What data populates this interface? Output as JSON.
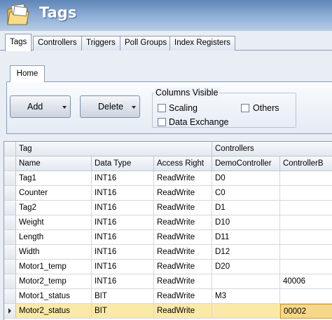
{
  "app": {
    "title": "Tags",
    "icon": "folder-tags-icon"
  },
  "tabs": [
    "Tags",
    "Controllers",
    "Triggers",
    "Poll Groups",
    "Index Registers"
  ],
  "ribbon": {
    "tab": "Home",
    "add_label": "Add",
    "delete_label": "Delete",
    "columns_visible_label": "Columns Visible",
    "checkboxes": {
      "scaling": "Scaling",
      "others": "Others",
      "data_exchange": "Data Exchange"
    }
  },
  "grid": {
    "group_tag": "Tag",
    "group_controllers": "Controllers",
    "columns": [
      "Name",
      "Data Type",
      "Access Right",
      "DemoController",
      "ControllerB"
    ],
    "rows": [
      [
        "Tag1",
        "INT16",
        "ReadWrite",
        "D0",
        ""
      ],
      [
        "Counter",
        "INT16",
        "ReadWrite",
        "C0",
        ""
      ],
      [
        "Tag2",
        "INT16",
        "ReadWrite",
        "D1",
        ""
      ],
      [
        "Weight",
        "INT16",
        "ReadWrite",
        "D10",
        ""
      ],
      [
        "Length",
        "INT16",
        "ReadWrite",
        "D11",
        ""
      ],
      [
        "Width",
        "INT16",
        "ReadWrite",
        "D12",
        ""
      ],
      [
        "Motor1_temp",
        "INT16",
        "ReadWrite",
        "D20",
        ""
      ],
      [
        "Motor2_temp",
        "INT16",
        "ReadWrite",
        "",
        "40006"
      ],
      [
        "Motor1_status",
        "BIT",
        "ReadWrite",
        "M3",
        ""
      ],
      [
        "Motor2_status",
        "BIT",
        "ReadWrite",
        "",
        "00002"
      ]
    ],
    "selected_row": 9
  },
  "colors": {
    "selection": "#fbe9a8",
    "selected_cell": "#f7d88a",
    "title_gradient_top": "#5f86b8"
  }
}
